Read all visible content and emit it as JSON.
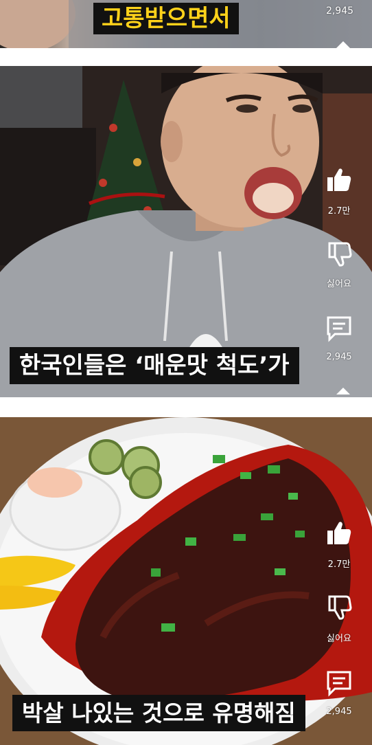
{
  "frame1": {
    "caption": "고통받으면서",
    "counter": "2,945"
  },
  "frame2": {
    "caption": "한국인들은 ‘매운맛 척도’가",
    "like_count": "2.7만",
    "dislike_label": "싫어요",
    "comment_count": "2,945"
  },
  "frame3": {
    "caption": "박살 나있는 것으로 유명해짐",
    "like_count": "2.7만",
    "dislike_label": "싫어요",
    "comment_count": "2,945"
  },
  "colors": {
    "caption_bg": "#111111",
    "caption_yellow": "#ffd21a",
    "icon": "#ffffff"
  }
}
